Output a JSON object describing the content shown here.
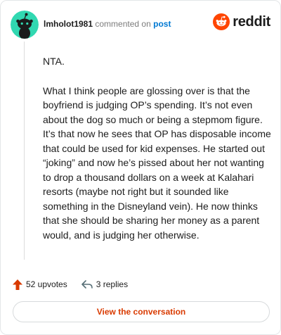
{
  "header": {
    "username": "lmholot1981",
    "action_text": "commented on",
    "post_link": "post",
    "brand": "reddit",
    "brand_color": "#ff4500",
    "avatar_color": "#31d8b1"
  },
  "comment": {
    "paragraphs": [
      "NTA.",
      "What I think people are glossing over is that the boyfriend is judging OP’s spending. It’s not even about the dog so much or being a stepmom figure. It’s that now he sees that OP has disposable income that could be used for kid expenses. He started out “joking” and now he’s pissed about her not wanting to drop a thousand dollars on a week at Kalahari resorts (maybe not right but it sounded like something in the Disneyland vein). He now thinks that she should be sharing her money as a parent would, and is judging her otherwise."
    ]
  },
  "actions": {
    "upvotes": "52 upvotes",
    "replies": "3 replies",
    "upvote_icon": "upvote-arrow-icon",
    "reply_icon": "reply-arrow-icon"
  },
  "footer": {
    "view_button": "View the conversation"
  }
}
